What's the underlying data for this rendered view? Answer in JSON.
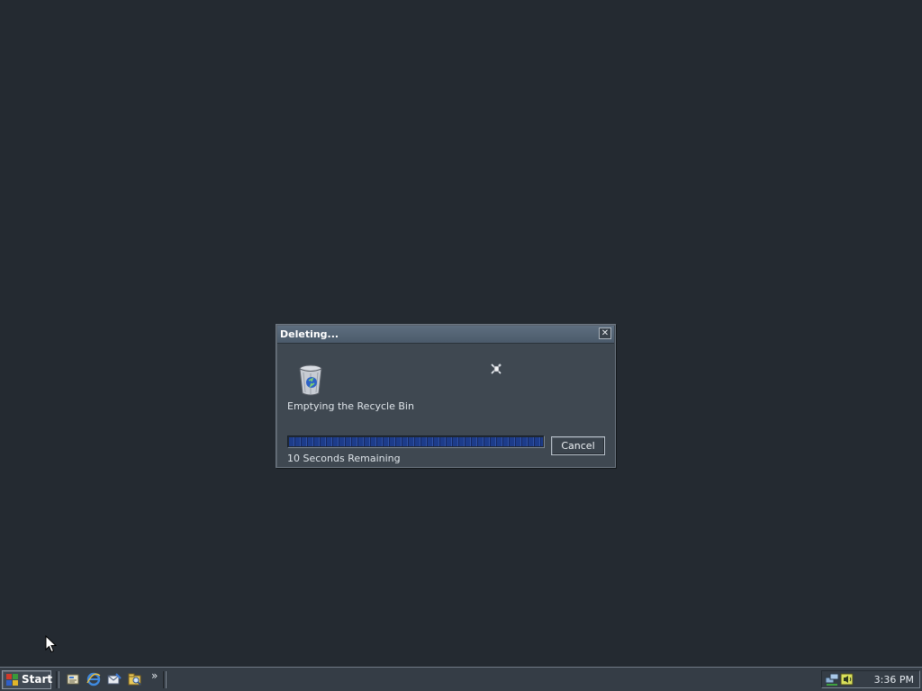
{
  "dialog": {
    "title": "Deleting...",
    "close_symbol": "✕",
    "message": "Emptying the Recycle Bin",
    "progress_fraction": 1.0,
    "time_remaining": "10 Seconds Remaining",
    "cancel_label": "Cancel",
    "icons": [
      "recycle-bin-icon",
      "flying-paper-icon"
    ]
  },
  "taskbar": {
    "start_label": "Start",
    "quick_launch": [
      "show-desktop-icon",
      "internet-explorer-icon",
      "outlook-express-icon",
      "windows-explorer-icon"
    ],
    "overflow_symbol": "»",
    "tray_icons": [
      "network-icon",
      "volume-icon"
    ],
    "clock": "3:36 PM"
  },
  "colors": {
    "desktop": "#242a31",
    "dialog_bg": "#3f4851",
    "titlebar": "#56657a",
    "progress_block": "#1d3c8a",
    "taskbar": "#353d46"
  }
}
